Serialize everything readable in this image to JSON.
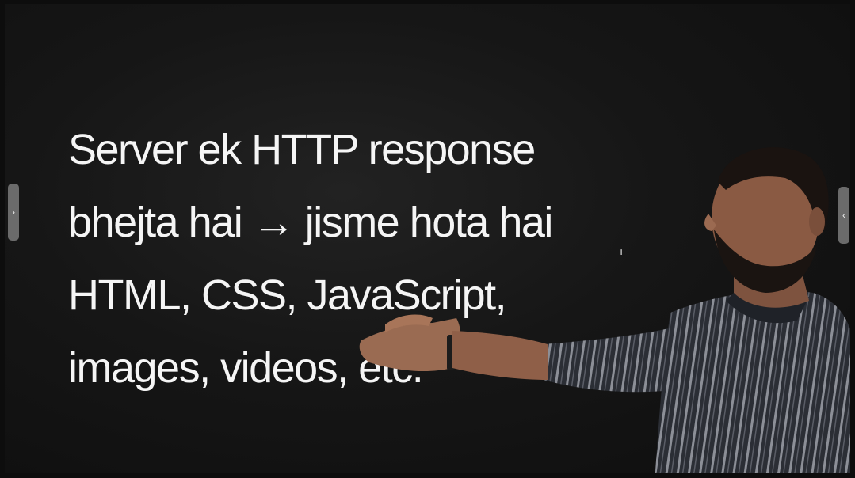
{
  "slide": {
    "lines": [
      "Server ek HTTP response",
      "bhejta hai → jisme hota hai",
      "HTML, CSS, JavaScript,",
      "images, videos, etc."
    ]
  },
  "controls": {
    "left_icon": "chevron-right-icon",
    "left_glyph": "›",
    "right_icon": "chevron-left-icon",
    "right_glyph": "‹"
  },
  "colors": {
    "background": "#141414",
    "text": "#f5f5f5",
    "handle": "#6b6b6b"
  }
}
